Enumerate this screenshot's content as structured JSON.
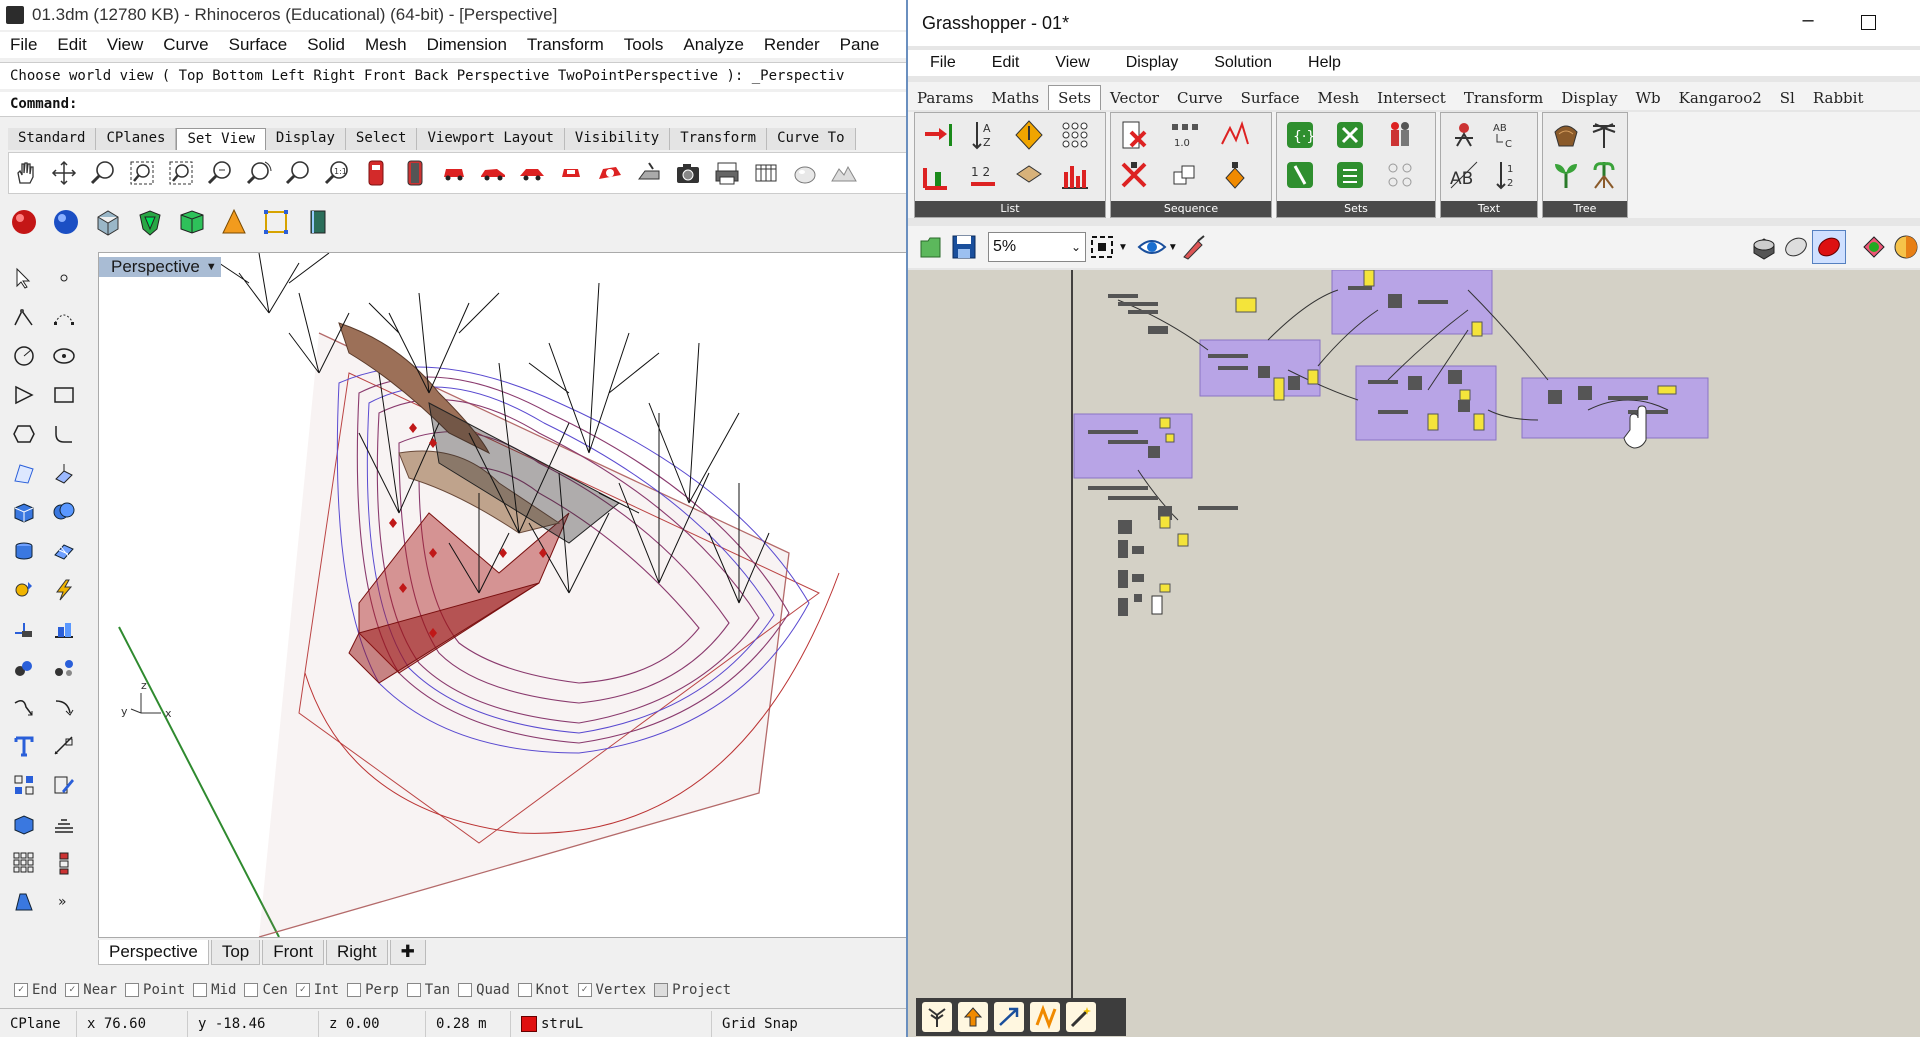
{
  "rhino": {
    "title": "01.3dm (12780 KB) - Rhinoceros (Educational) (64-bit) - [Perspective]",
    "menu": [
      "File",
      "Edit",
      "View",
      "Curve",
      "Surface",
      "Solid",
      "Mesh",
      "Dimension",
      "Transform",
      "Tools",
      "Analyze",
      "Render",
      "Pane"
    ],
    "command_history": "Choose world view ( Top  Bottom  Left  Right  Front  Back  Perspective  TwoPointPerspective ): _Perspectiv",
    "command_prompt": "Command:",
    "toolbar_tabs": [
      "Standard",
      "CPlanes",
      "Set View",
      "Display",
      "Select",
      "Viewport Layout",
      "Visibility",
      "Transform",
      "Curve To"
    ],
    "active_toolbar_tab": "Set View",
    "toolbar_icons": [
      "pan-icon",
      "rotate-icon",
      "zoom-icon",
      "zoom-window-icon",
      "zoom-extents-icon",
      "zoom-selected-icon",
      "zoom-dynamic-icon",
      "zoom-out-icon",
      "zoom-1to1-icon",
      "camera-red-icon",
      "camera-dark-icon",
      "car-front-icon",
      "car-side-icon",
      "car-back-icon",
      "car-top-icon",
      "car-rotate-icon",
      "set-camera-icon",
      "camera-icon",
      "print-icon",
      "save-view-icon",
      "sphere-icon",
      "mountain-icon"
    ],
    "render_icons": [
      "render-red-sphere-icon",
      "render-blue-sphere-icon",
      "wireframe-box-icon",
      "green-shield-icon",
      "green-cube-icon",
      "cone-icon",
      "box-frame-icon",
      "book-icon"
    ],
    "viewport_title": "Perspective",
    "viewport_tabs": [
      "Perspective",
      "Top",
      "Front",
      "Right"
    ],
    "active_viewport": "Perspective",
    "osnaps": [
      {
        "label": "End",
        "checked": true
      },
      {
        "label": "Near",
        "checked": true
      },
      {
        "label": "Point",
        "checked": false
      },
      {
        "label": "Mid",
        "checked": false
      },
      {
        "label": "Cen",
        "checked": false
      },
      {
        "label": "Int",
        "checked": true
      },
      {
        "label": "Perp",
        "checked": false
      },
      {
        "label": "Tan",
        "checked": false
      },
      {
        "label": "Quad",
        "checked": false
      },
      {
        "label": "Knot",
        "checked": false
      },
      {
        "label": "Vertex",
        "checked": true
      },
      {
        "label": "Project",
        "checked": false
      }
    ],
    "status": {
      "cplane": "CPlane",
      "x": "x 76.60",
      "y": "y -18.46",
      "z": "z 0.00",
      "distance": "0.28 m",
      "layer": "struL",
      "layer_color": "#e01010",
      "grid_snap": "Grid Snap"
    },
    "axis_labels": {
      "x": "x",
      "y": "y",
      "z": "z"
    }
  },
  "grasshopper": {
    "title": "Grasshopper - 01*",
    "menu": [
      "File",
      "Edit",
      "View",
      "Display",
      "Solution",
      "Help"
    ],
    "tabs": [
      "Params",
      "Maths",
      "Sets",
      "Vector",
      "Curve",
      "Surface",
      "Mesh",
      "Intersect",
      "Transform",
      "Display",
      "Wb",
      "Kangaroo2",
      "Sl",
      "Rabbit"
    ],
    "active_tab": "Sets",
    "ribbon_groups": [
      {
        "label": "List",
        "icons": [
          "list-item-icon",
          "list-sort-icon",
          "dispatch-icon",
          "null-item-icon",
          "shift-list-icon",
          "bar-list-icon"
        ]
      },
      {
        "label": "Sequence",
        "icons": [
          "cull-index-icon",
          "cull-pattern-icon",
          "series-icon",
          "range-icon",
          "graph-icon",
          "random-icon"
        ]
      },
      {
        "label": "Sets",
        "icons": [
          "set-union-icon",
          "set-intersect-icon",
          "set-difference-icon",
          "set-exclusive-icon",
          "people-icon",
          "set-grid-icon"
        ]
      },
      {
        "label": "Text",
        "icons": [
          "text-split-icon",
          "text-ab-icon",
          "text-concat-icon",
          "text-sort-icon"
        ]
      },
      {
        "label": "Tree",
        "icons": [
          "tree-stump-icon",
          "tree-palm-icon",
          "tree-sprout-icon",
          "tree-root-icon"
        ]
      }
    ],
    "zoom": "5%",
    "canvas_tools": [
      "open-icon",
      "save-icon",
      "zoom-extents-icon",
      "preview-eye-icon",
      "sketch-icon",
      "preview-mode-icon",
      "wire-preview-icon",
      "shaded-preview-icon",
      "gumball-icon",
      "color-picker-icon"
    ],
    "bottom_icons": [
      "tree-icon",
      "bake-icon",
      "arrow-icon",
      "bundle-icon",
      "wand-icon"
    ]
  }
}
